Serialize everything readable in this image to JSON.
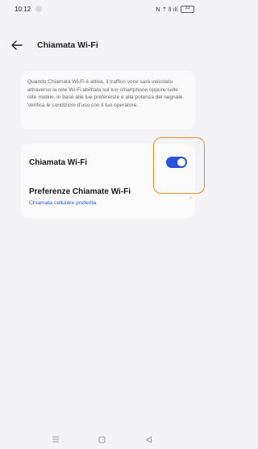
{
  "status_bar": {
    "time": "10:12",
    "icons_text": "N ⇡ ll ıll",
    "battery": "33"
  },
  "header": {
    "back_icon": "arrow-left-icon",
    "title": "Chiamata Wi-Fi"
  },
  "info": {
    "text": "Quando Chiamata Wi-Fi è attiva, il traffico voce sarà veicolato attraverso la rete Wi-Fi abilitata sul tuo smartphone oppure sulle rete mobile, in base alle tue preferenze e alla potenza del segnale. Verifica le condizioni d'uso con il tuo operatore."
  },
  "settings": {
    "wifi_calling_label": "Chiamata Wi-Fi",
    "wifi_calling_enabled": true,
    "preferences_label": "Preferenze Chiamate Wi-Fi",
    "preferences_value": "Chiamata cellulare preferita"
  },
  "colors": {
    "accent": "#2a52e0",
    "highlight": "#f08a2a"
  },
  "nav": {
    "menu_icon": "menu-icon",
    "home_icon": "home-square-icon",
    "back_icon": "back-triangle-icon"
  }
}
